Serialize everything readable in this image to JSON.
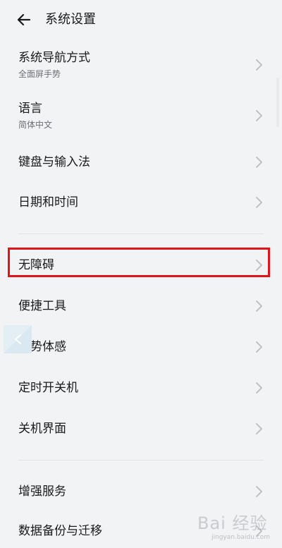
{
  "header": {
    "back_icon": "arrow-left-icon",
    "title": "系统设置"
  },
  "menu": {
    "items": [
      {
        "label": "系统导航方式",
        "sublabel": "全面屏手势"
      },
      {
        "label": "语言",
        "sublabel": "简体中文"
      },
      {
        "label": "键盘与输入法"
      },
      {
        "label": "日期和时间"
      },
      {
        "label": "无障碍",
        "highlighted": true
      },
      {
        "label": "便捷工具"
      },
      {
        "label": "手势体感"
      },
      {
        "label": "定时开关机"
      },
      {
        "label": "关机界面"
      },
      {
        "label": "增强服务"
      },
      {
        "label": "数据备份与迁移"
      }
    ]
  },
  "colors": {
    "background": "#f2f3f5",
    "highlight_border": "#e0141b",
    "chevron": "#b8bbc0",
    "subtitle": "#6b6f76"
  },
  "watermark": {
    "main": "Bai 经验",
    "sub": "jingyan.baidu.com"
  }
}
